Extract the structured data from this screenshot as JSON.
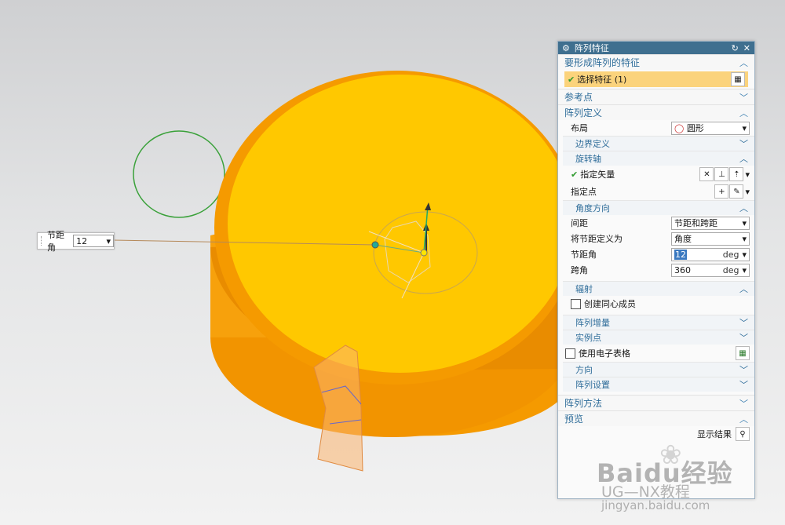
{
  "viewport": {
    "floating_field": {
      "label": "节距角",
      "value": "12"
    }
  },
  "dialog": {
    "title": "阵列特征",
    "sections": {
      "features_to_pattern": {
        "title": "要形成阵列的特征",
        "select_feature_label": "选择特征 (1)"
      },
      "reference_point": {
        "title": "参考点"
      },
      "pattern_definition": {
        "title": "阵列定义",
        "layout_label": "布局",
        "layout_value": "圆形",
        "boundary": "边界定义",
        "rotation_axis": {
          "title": "旋转轴",
          "specify_vector": "指定矢量",
          "specify_point": "指定点"
        },
        "angle_direction": {
          "title": "角度方向",
          "spacing_label": "间距",
          "spacing_value": "节距和跨距",
          "define_pitch_label": "将节距定义为",
          "define_pitch_value": "角度",
          "pitch_angle_label": "节距角",
          "pitch_angle_value": "12",
          "pitch_angle_unit": "deg",
          "span_angle_label": "跨角",
          "span_angle_value": "360",
          "span_angle_unit": "deg"
        },
        "radiate": {
          "title": "辐射",
          "create_concentric_label": "创建同心成员"
        },
        "pattern_increment": "阵列增量",
        "instance_points": "实例点",
        "use_spreadsheet_label": "使用电子表格",
        "orientation": "方向",
        "pattern_settings": "阵列设置"
      },
      "pattern_method": {
        "title": "阵列方法"
      },
      "preview": {
        "title": "预览",
        "show_result_label": "显示结果"
      }
    }
  },
  "watermark": {
    "brand": "Baidu经验",
    "channel": "UG—NX教程",
    "url": "jingyan.baidu.com"
  },
  "colors": {
    "disk_top": "#ffc800",
    "disk_side": "#f59a00",
    "titlebar": "#3f6f8f",
    "section_text": "#2f6d9a",
    "selection_highlight": "#fbd37c"
  }
}
